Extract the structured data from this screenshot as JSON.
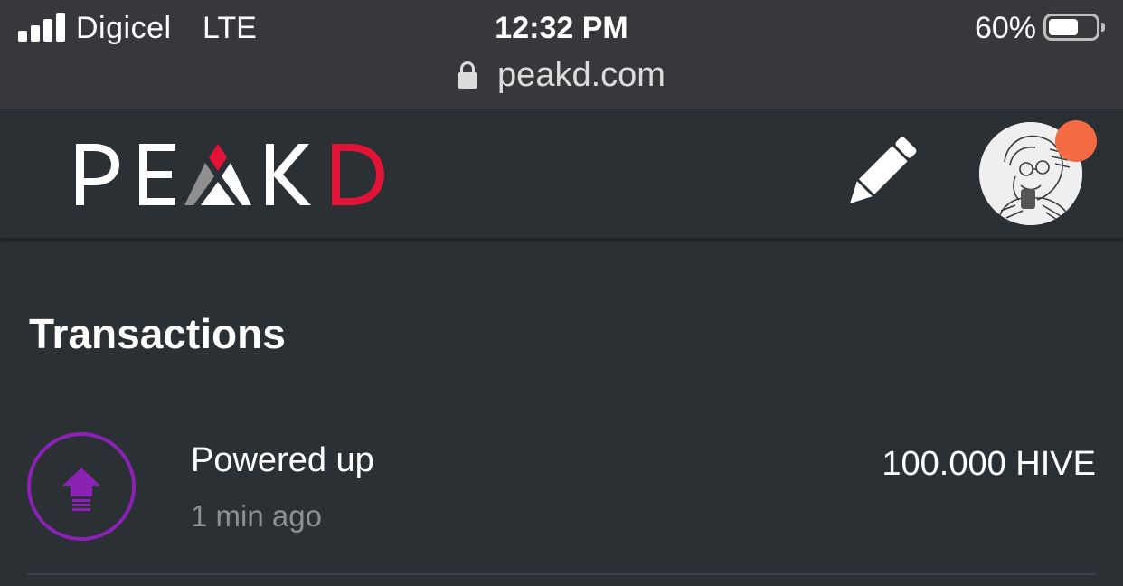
{
  "status_bar": {
    "carrier": "Digicel",
    "network": "LTE",
    "time": "12:32 PM",
    "battery_percent": "60%",
    "battery_level": 0.6,
    "url": "peakd.com"
  },
  "header": {
    "logo_text": "PEAKD",
    "logo_colors": {
      "letters": "#ffffff",
      "accent_red": "#e31337",
      "accent_grey": "#8f8f8f"
    },
    "icons": [
      "pencil-icon",
      "avatar",
      "notification-dot"
    ],
    "notification_color": "#f46a43"
  },
  "main": {
    "section_title": "Transactions",
    "transactions": [
      {
        "type": "Powered up",
        "time": "1 min ago",
        "amount": "100.000 HIVE",
        "icon": "power-up-arrow-icon",
        "icon_color": "#8a22b3"
      }
    ]
  }
}
